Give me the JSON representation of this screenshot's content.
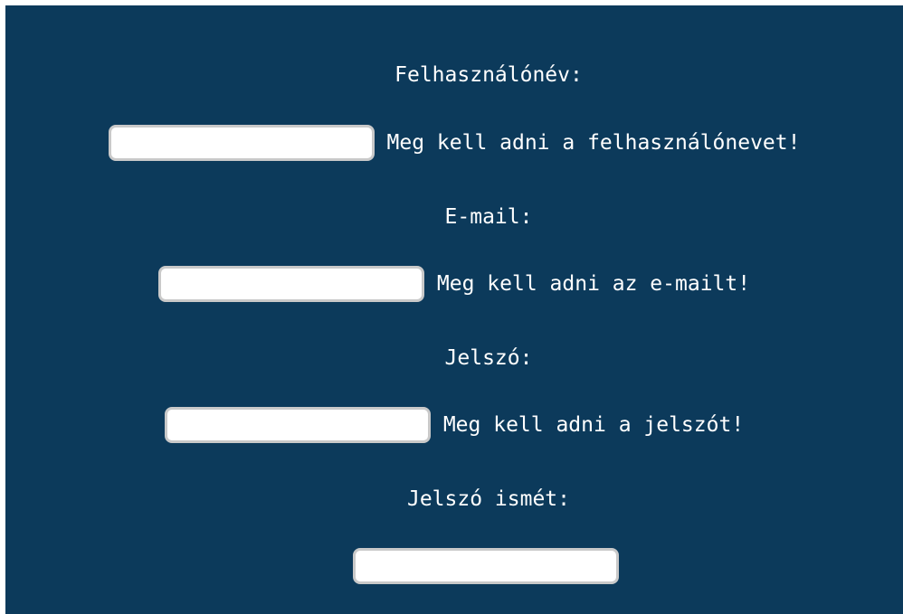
{
  "form": {
    "username": {
      "label": "Felhasználónév:",
      "value": "",
      "error": "Meg kell adni a felhasználónevet!"
    },
    "email": {
      "label": "E-mail:",
      "value": "",
      "error": "Meg kell adni az e-mailt!"
    },
    "password": {
      "label": "Jelszó:",
      "value": "",
      "error": "Meg kell adni a jelszót!"
    },
    "password_repeat": {
      "label": "Jelszó ismét:",
      "value": ""
    }
  },
  "colors": {
    "background": "#0c3a5b",
    "text": "#ffffff",
    "input_background": "#ffffff",
    "input_border": "#c9c9c9"
  }
}
